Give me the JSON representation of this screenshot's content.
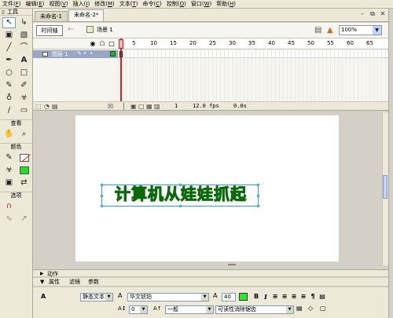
{
  "menu": [
    {
      "label": "文件",
      "key": "F"
    },
    {
      "label": "编辑",
      "key": "E"
    },
    {
      "label": "视图",
      "key": "V"
    },
    {
      "label": "插入",
      "key": "I"
    },
    {
      "label": "修改",
      "key": "M"
    },
    {
      "label": "文本",
      "key": "T"
    },
    {
      "label": "命令",
      "key": "C"
    },
    {
      "label": "控制",
      "key": "O"
    },
    {
      "label": "窗口",
      "key": "W"
    },
    {
      "label": "帮助",
      "key": "H"
    }
  ],
  "tools": {
    "title": "工具",
    "view_label": "查看",
    "color_label": "颜色",
    "options_label": "选项"
  },
  "doc_tabs": [
    {
      "label": "未命名-1"
    },
    {
      "label": "未命名-2*"
    }
  ],
  "editbar": {
    "timeline_button": "时间轴",
    "scene": "场景 1",
    "zoom": "100%"
  },
  "timeline": {
    "frame_numbers": [
      "5",
      "10",
      "15",
      "20",
      "25",
      "30",
      "35",
      "40",
      "45",
      "50",
      "55",
      "60",
      "65"
    ],
    "layer_name": "图层 1",
    "status": {
      "current_frame": "1",
      "fps": "12.0 fps",
      "elapsed": "0.0s"
    }
  },
  "stage": {
    "text": "计算机从娃娃抓起"
  },
  "panels": {
    "actions_label": "动作",
    "tabs": [
      "属性",
      "滤镜",
      "参数"
    ]
  },
  "properties": {
    "text_type": "静态文本",
    "font_family": "华文琥珀",
    "font_size": "40",
    "letter_spacing": "0",
    "baseline": "一般",
    "anti_alias": "可读性消除锯齿"
  },
  "colors": {
    "text_fill": "#22e022",
    "text_stroke": "#0a6a0a",
    "selection": "#2ea0e8",
    "playhead": "#e02020"
  }
}
